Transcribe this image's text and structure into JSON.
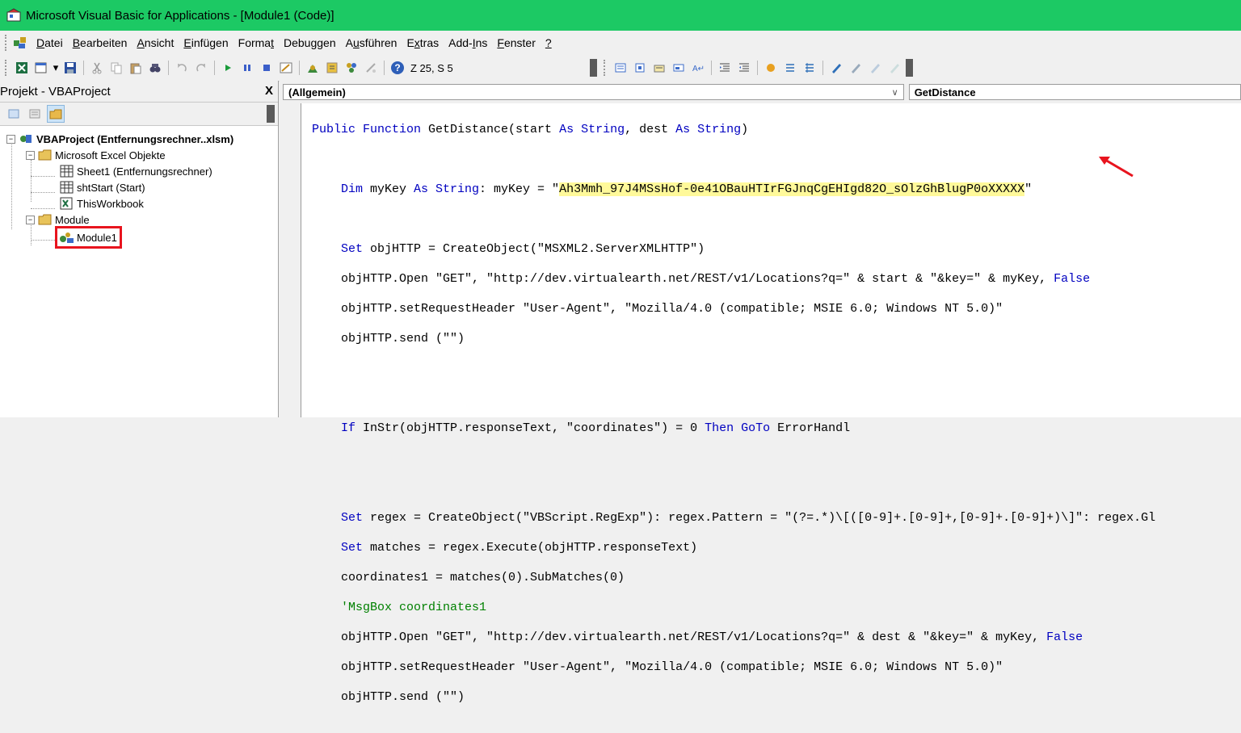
{
  "title": "Microsoft Visual Basic for Applications - [Module1 (Code)]",
  "menu": [
    {
      "pre": "",
      "u": "D",
      "post": "atei"
    },
    {
      "pre": "",
      "u": "B",
      "post": "earbeiten"
    },
    {
      "pre": "",
      "u": "A",
      "post": "nsicht"
    },
    {
      "pre": "",
      "u": "E",
      "post": "infügen"
    },
    {
      "pre": "Forma",
      "u": "t",
      "post": ""
    },
    {
      "pre": "Debu",
      "u": "g",
      "post": "gen"
    },
    {
      "pre": "A",
      "u": "u",
      "post": "sführen"
    },
    {
      "pre": "E",
      "u": "x",
      "post": "tras"
    },
    {
      "pre": "Add-",
      "u": "I",
      "post": "ns"
    },
    {
      "pre": "",
      "u": "F",
      "post": "enster"
    },
    {
      "pre": "",
      "u": "?",
      "post": ""
    }
  ],
  "position": "Z 25, S 5",
  "project": {
    "title": "Projekt - VBAProject",
    "close": "X",
    "root": "VBAProject (Entfernungsrechner..xlsm)",
    "excel_folder": "Microsoft Excel Objekte",
    "sheet1": "Sheet1 (Entfernungsrechner)",
    "shtstart": "shtStart (Start)",
    "thisworkbook": "ThisWorkbook",
    "module_folder": "Module",
    "module1": "Module1"
  },
  "combos": {
    "object": "(Allgemein)",
    "proc": "GetDistance"
  },
  "code": {
    "l1": [
      "Public Function",
      " GetDistance(start ",
      "As String",
      ", dest ",
      "As String",
      ")"
    ],
    "l2": [
      "    Dim",
      " myKey ",
      "As String",
      ": myKey = \"",
      "Ah3Mmh_97J4MSsHof-0e41OBauHTIrFGJnqCgEHIgd82O_sOlzGhBlugP0oXXXXX",
      "\""
    ],
    "l3": [
      "    Set",
      " objHTTP = CreateObject(\"MSXML2.ServerXMLHTTP\")"
    ],
    "l4": [
      "    objHTTP.Open \"GET\", \"http://dev.virtualearth.net/REST/v1/Locations?q=\" & start & \"&key=\" & myKey, ",
      "False"
    ],
    "l5": "    objHTTP.setRequestHeader \"User-Agent\", \"Mozilla/4.0 (compatible; MSIE 6.0; Windows NT 5.0)\"",
    "l6": "    objHTTP.send (\"\")",
    "l7": [
      "    If",
      " InStr(objHTTP.responseText, \"coordinates\") = 0 ",
      "Then",
      " ",
      "GoTo",
      " ErrorHandl"
    ],
    "l8": [
      "    Set",
      " regex = CreateObject(\"VBScript.RegExp\"): regex.Pattern = \"(?=.*)\\[([0-9]+.[0-9]+,[0-9]+.[0-9]+)\\]\": regex.Gl"
    ],
    "l9": [
      "    Set",
      " matches = regex.Execute(objHTTP.responseText)"
    ],
    "l10": "    coordinates1 = matches(0).SubMatches(0)",
    "l11": "    'MsgBox coordinates1",
    "l12": [
      "    objHTTP.Open \"GET\", \"http://dev.virtualearth.net/REST/v1/Locations?q=\" & dest & \"&key=\" & myKey, ",
      "False"
    ],
    "l13": "    objHTTP.setRequestHeader \"User-Agent\", \"Mozilla/4.0 (compatible; MSIE 6.0; Windows NT 5.0)\"",
    "l14": "    objHTTP.send (\"\")"
  },
  "colors": {
    "titlebar": "#1cc964",
    "keyword": "#0000c0",
    "comment": "#008000",
    "highlight": "#fff99a",
    "annotation": "#e8141e"
  }
}
